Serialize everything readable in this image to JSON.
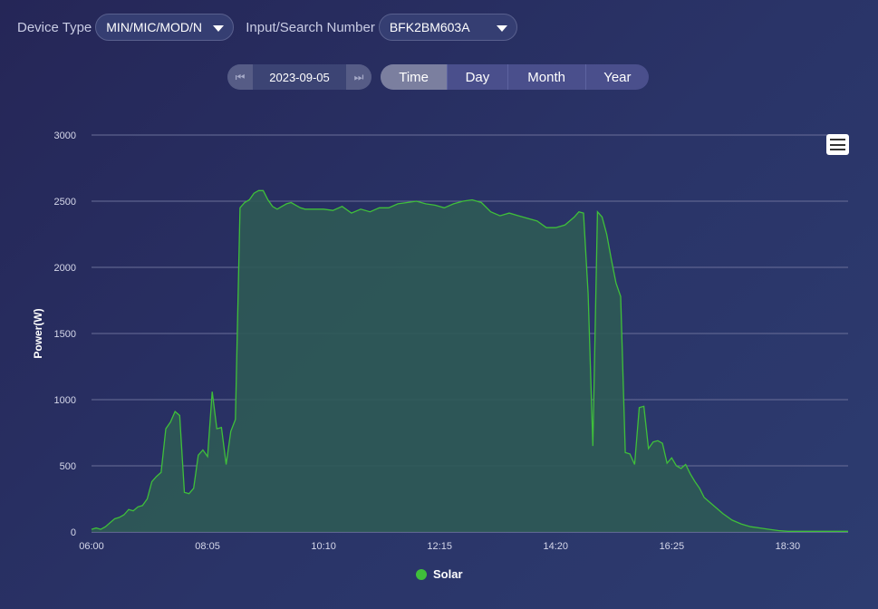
{
  "filters": {
    "device_type_label": "Device Type",
    "device_type_value": "MIN/MIC/MOD/N",
    "search_label": "Input/Search Number",
    "search_value": "BFK2BM603A"
  },
  "date": {
    "value": "2023-09-05"
  },
  "range_tabs": [
    "Time",
    "Day",
    "Month",
    "Year"
  ],
  "active_tab": "Time",
  "icons": {
    "prev": "first-page-icon",
    "next": "last-page-icon",
    "menu": "hamburger-menu-icon"
  },
  "colors": {
    "solar_line": "#3fbf3a",
    "solar_fill": "#2e5a55",
    "legend_dot": "#3fbf3a"
  },
  "chart_data": {
    "type": "area",
    "ylabel": "Power(W)",
    "xlabel": "",
    "ylim": [
      0,
      3000
    ],
    "y_ticks": [
      0,
      500,
      1000,
      1500,
      2000,
      2500,
      3000
    ],
    "x_ticks": [
      "06:00",
      "08:05",
      "10:10",
      "12:15",
      "14:20",
      "16:25",
      "18:30"
    ],
    "x_range": [
      "06:00",
      "19:35"
    ],
    "grid": true,
    "legend_position": "bottom",
    "series": [
      {
        "name": "Solar",
        "points": [
          [
            "06:00",
            20
          ],
          [
            "06:05",
            30
          ],
          [
            "06:10",
            20
          ],
          [
            "06:15",
            40
          ],
          [
            "06:20",
            70
          ],
          [
            "06:25",
            100
          ],
          [
            "06:30",
            110
          ],
          [
            "06:35",
            130
          ],
          [
            "06:40",
            170
          ],
          [
            "06:45",
            160
          ],
          [
            "06:50",
            190
          ],
          [
            "06:55",
            200
          ],
          [
            "07:00",
            250
          ],
          [
            "07:05",
            380
          ],
          [
            "07:10",
            420
          ],
          [
            "07:15",
            450
          ],
          [
            "07:20",
            780
          ],
          [
            "07:25",
            830
          ],
          [
            "07:30",
            910
          ],
          [
            "07:35",
            880
          ],
          [
            "07:40",
            300
          ],
          [
            "07:45",
            290
          ],
          [
            "07:50",
            330
          ],
          [
            "07:55",
            580
          ],
          [
            "08:00",
            620
          ],
          [
            "08:05",
            570
          ],
          [
            "08:10",
            1060
          ],
          [
            "08:15",
            780
          ],
          [
            "08:20",
            790
          ],
          [
            "08:25",
            510
          ],
          [
            "08:30",
            760
          ],
          [
            "08:35",
            850
          ],
          [
            "08:40",
            2450
          ],
          [
            "08:45",
            2490
          ],
          [
            "08:50",
            2510
          ],
          [
            "08:55",
            2560
          ],
          [
            "09:00",
            2580
          ],
          [
            "09:05",
            2580
          ],
          [
            "09:10",
            2510
          ],
          [
            "09:15",
            2460
          ],
          [
            "09:20",
            2440
          ],
          [
            "09:25",
            2460
          ],
          [
            "09:30",
            2480
          ],
          [
            "09:35",
            2490
          ],
          [
            "09:40",
            2470
          ],
          [
            "09:45",
            2450
          ],
          [
            "09:50",
            2440
          ],
          [
            "09:55",
            2440
          ],
          [
            "10:00",
            2440
          ],
          [
            "10:10",
            2440
          ],
          [
            "10:20",
            2430
          ],
          [
            "10:30",
            2460
          ],
          [
            "10:40",
            2410
          ],
          [
            "10:50",
            2440
          ],
          [
            "11:00",
            2420
          ],
          [
            "11:10",
            2450
          ],
          [
            "11:20",
            2450
          ],
          [
            "11:30",
            2480
          ],
          [
            "11:40",
            2490
          ],
          [
            "11:50",
            2500
          ],
          [
            "12:00",
            2480
          ],
          [
            "12:10",
            2470
          ],
          [
            "12:20",
            2450
          ],
          [
            "12:30",
            2480
          ],
          [
            "12:40",
            2500
          ],
          [
            "12:50",
            2510
          ],
          [
            "13:00",
            2490
          ],
          [
            "13:10",
            2420
          ],
          [
            "13:20",
            2390
          ],
          [
            "13:30",
            2410
          ],
          [
            "13:40",
            2390
          ],
          [
            "13:50",
            2370
          ],
          [
            "14:00",
            2350
          ],
          [
            "14:10",
            2300
          ],
          [
            "14:20",
            2300
          ],
          [
            "14:30",
            2320
          ],
          [
            "14:40",
            2380
          ],
          [
            "14:45",
            2420
          ],
          [
            "14:50",
            2410
          ],
          [
            "14:55",
            1800
          ],
          [
            "15:00",
            650
          ],
          [
            "15:05",
            2420
          ],
          [
            "15:10",
            2380
          ],
          [
            "15:15",
            2250
          ],
          [
            "15:20",
            2060
          ],
          [
            "15:25",
            1880
          ],
          [
            "15:30",
            1780
          ],
          [
            "15:35",
            600
          ],
          [
            "15:40",
            590
          ],
          [
            "15:45",
            510
          ],
          [
            "15:50",
            940
          ],
          [
            "15:55",
            950
          ],
          [
            "16:00",
            630
          ],
          [
            "16:05",
            680
          ],
          [
            "16:10",
            690
          ],
          [
            "16:15",
            670
          ],
          [
            "16:20",
            520
          ],
          [
            "16:25",
            560
          ],
          [
            "16:30",
            500
          ],
          [
            "16:35",
            480
          ],
          [
            "16:40",
            510
          ],
          [
            "16:45",
            440
          ],
          [
            "16:50",
            380
          ],
          [
            "16:55",
            330
          ],
          [
            "17:00",
            260
          ],
          [
            "17:10",
            200
          ],
          [
            "17:20",
            140
          ],
          [
            "17:30",
            90
          ],
          [
            "17:40",
            60
          ],
          [
            "17:50",
            40
          ],
          [
            "18:00",
            30
          ],
          [
            "18:10",
            20
          ],
          [
            "18:20",
            10
          ],
          [
            "18:30",
            5
          ],
          [
            "19:35",
            5
          ]
        ]
      }
    ]
  }
}
